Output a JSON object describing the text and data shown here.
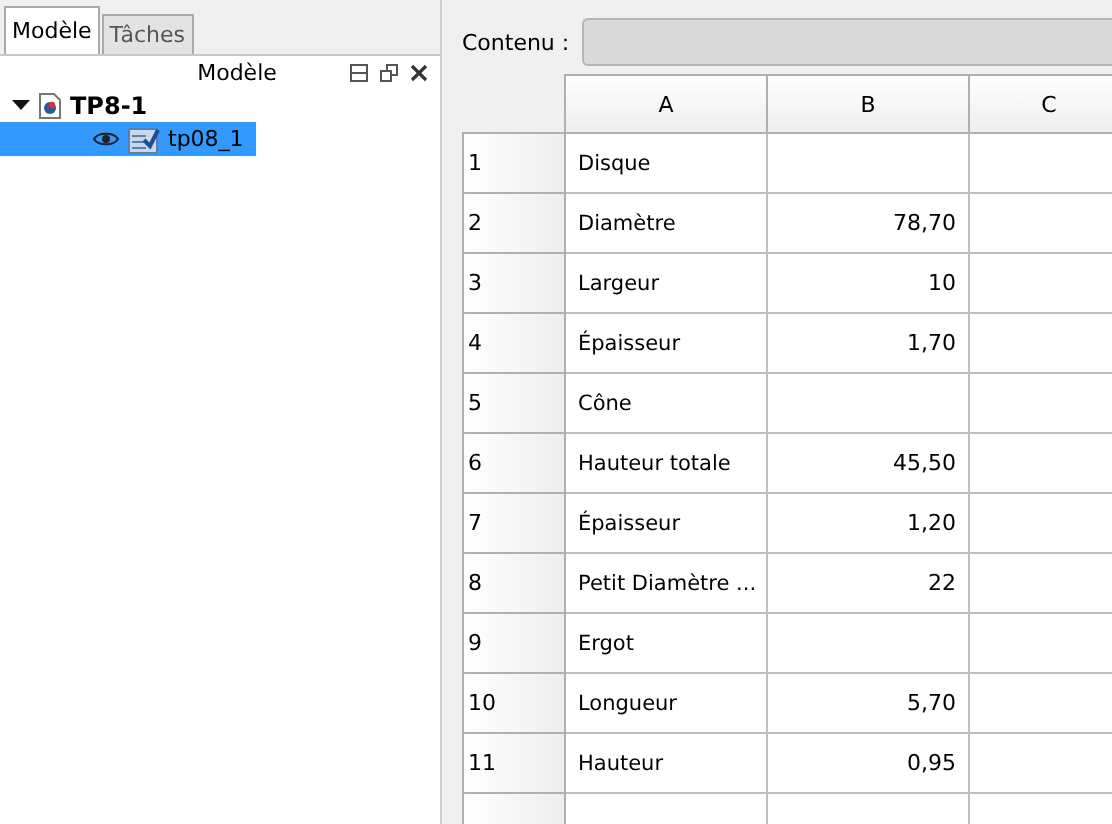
{
  "tabs": [
    {
      "label": "Modèle",
      "selected": true
    },
    {
      "label": "Tâches",
      "selected": false
    }
  ],
  "panel": {
    "title": "Modèle"
  },
  "tree": [
    {
      "label": "TP8-1",
      "expanded": true,
      "children": [
        {
          "label": "tp08_1",
          "selected": true,
          "visible": true
        }
      ]
    }
  ],
  "content": {
    "label": "Contenu :"
  },
  "table": {
    "columns": [
      "A",
      "B",
      "C"
    ],
    "rows": [
      {
        "header": "1",
        "cells": [
          "Disque",
          "",
          ""
        ]
      },
      {
        "header": "2",
        "cells": [
          "Diamètre",
          "78,70",
          ""
        ]
      },
      {
        "header": "3",
        "cells": [
          "Largeur",
          "10",
          ""
        ]
      },
      {
        "header": "4",
        "cells": [
          "Épaisseur",
          "1,70",
          ""
        ]
      },
      {
        "header": "5",
        "cells": [
          "Cône",
          "",
          ""
        ]
      },
      {
        "header": "6",
        "cells": [
          "Hauteur totale",
          "45,50",
          ""
        ]
      },
      {
        "header": "7",
        "cells": [
          "Épaisseur",
          "1,20",
          ""
        ]
      },
      {
        "header": "8",
        "cells": [
          "Petit Diamètre ...",
          "22",
          ""
        ]
      },
      {
        "header": "9",
        "cells": [
          "Ergot",
          "",
          ""
        ]
      },
      {
        "header": "10",
        "cells": [
          "Longueur",
          "5,70",
          ""
        ]
      },
      {
        "header": "11",
        "cells": [
          "Hauteur",
          "0,95",
          ""
        ]
      }
    ]
  }
}
